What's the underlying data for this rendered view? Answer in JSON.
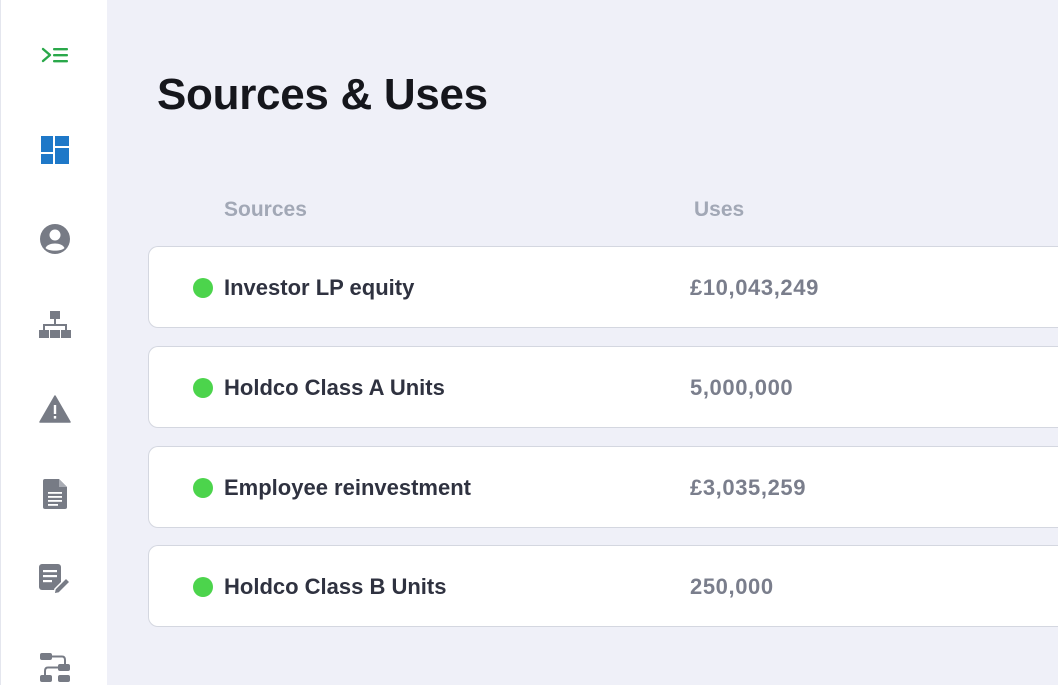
{
  "colors": {
    "accent_green": "#2aa84a",
    "accent_blue": "#1e78c8",
    "icon_gray": "#777b85",
    "status_dot": "#4cd44c",
    "background": "#eff0f8"
  },
  "sidebar": {
    "items": [
      {
        "icon": "collapse-menu-icon"
      },
      {
        "icon": "dashboard-icon"
      },
      {
        "icon": "user-icon"
      },
      {
        "icon": "org-chart-icon"
      },
      {
        "icon": "warning-icon"
      },
      {
        "icon": "document-icon"
      },
      {
        "icon": "edit-document-icon"
      },
      {
        "icon": "workflow-icon"
      }
    ]
  },
  "page": {
    "title": "Sources & Uses"
  },
  "table": {
    "columns": [
      "Sources",
      "Uses"
    ],
    "rows": [
      {
        "source": "Investor LP equity",
        "use": "£10,043,249"
      },
      {
        "source": "Holdco Class A Units",
        "use": "5,000,000"
      },
      {
        "source": "Employee reinvestment",
        "use": "£3,035,259"
      },
      {
        "source": "Holdco Class B Units",
        "use": "250,000"
      }
    ]
  }
}
